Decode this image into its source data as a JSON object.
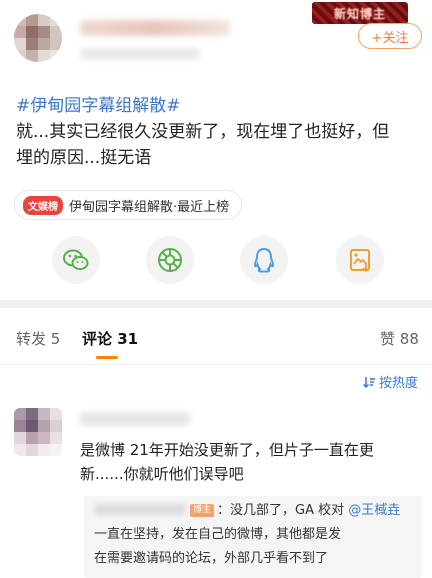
{
  "header": {
    "banner_label": "新知博主",
    "follow_label": "+关注"
  },
  "post": {
    "hashtag": "#伊甸园字幕组解散#",
    "line1": "就...其实已经很久没更新了，现在埋了也挺好，但",
    "line2": "埋的原因...挺无语"
  },
  "topic": {
    "tag": "文娱榜",
    "label": "伊甸园字幕组解散·最近上榜"
  },
  "share": {
    "items": [
      {
        "icon": "wechat-icon"
      },
      {
        "icon": "moments-icon"
      },
      {
        "icon": "qq-icon"
      },
      {
        "icon": "save-image-icon"
      }
    ]
  },
  "tabs": {
    "repost_label": "转发",
    "repost_count": "5",
    "comment_label": "评论",
    "comment_count": "31",
    "like_label": "赞",
    "like_count": "88"
  },
  "sort": {
    "label": "按热度"
  },
  "comment": {
    "line1": "是微博 21年开始没更新了，但片子一直在更",
    "line2": "新......你就听他们误导吧"
  },
  "reply": {
    "badge": "博主",
    "text1": "：没几部了，GA 校对",
    "mention": "@王棫垚",
    "line2": "一直在坚持，发在自己的微博，其他都是发",
    "line3": "在需要邀请码的论坛，外部几乎看不到了"
  },
  "colors": {
    "accent_orange": "#ff8200",
    "link_blue": "#3c79c8",
    "follow_orange": "#f07c3a"
  }
}
